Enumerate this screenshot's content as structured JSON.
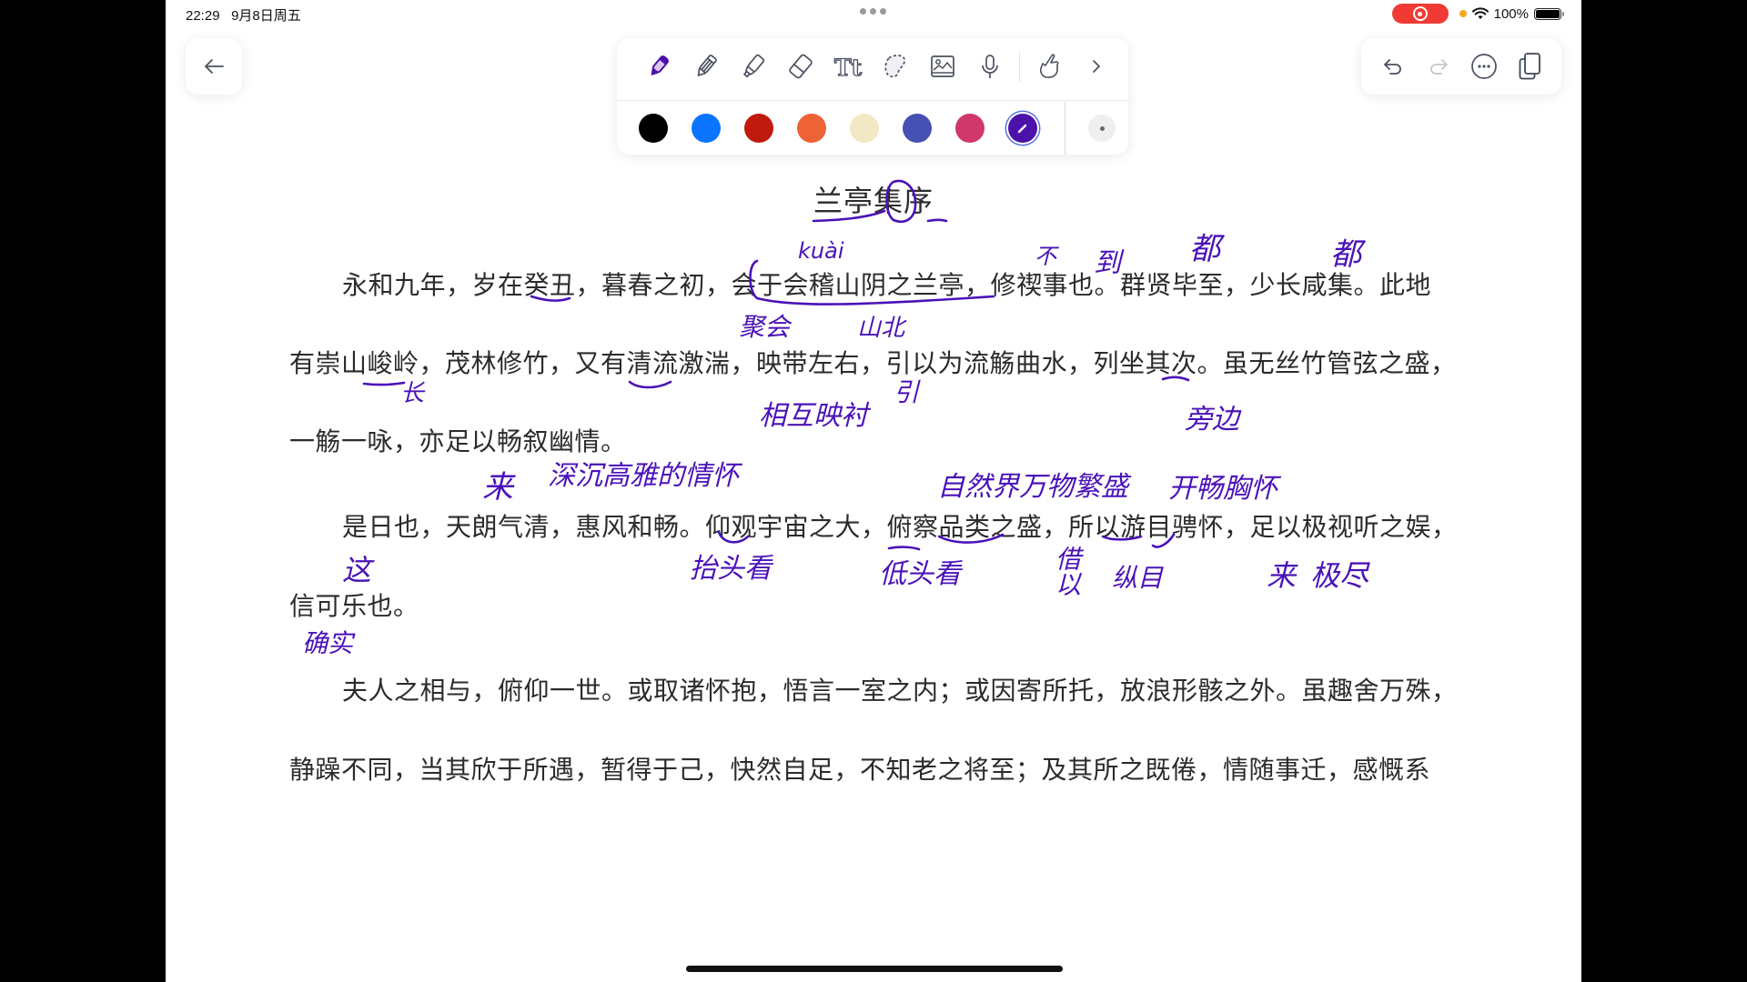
{
  "status_bar": {
    "time": "22:29",
    "date": "9月8日周五",
    "battery": "100%",
    "recording_color": "#ef3b34"
  },
  "nav": {
    "back_icon": "arrow-left-icon"
  },
  "toolbar": {
    "tools": [
      {
        "name": "pen",
        "icon": "fountain-pen-icon",
        "selected": true
      },
      {
        "name": "pencil",
        "icon": "pencil-icon"
      },
      {
        "name": "highlighter",
        "icon": "highlighter-icon"
      },
      {
        "name": "eraser",
        "icon": "eraser-icon"
      },
      {
        "name": "text",
        "icon": "text-tool-icon",
        "label": "Tt"
      },
      {
        "name": "lasso",
        "icon": "lasso-icon"
      },
      {
        "name": "image",
        "icon": "image-icon"
      },
      {
        "name": "microphone",
        "icon": "microphone-icon"
      },
      {
        "name": "touch-draw",
        "icon": "hand-pointer-icon"
      },
      {
        "name": "more-tools",
        "icon": "chevron-right-icon",
        "label": "›"
      }
    ],
    "colors": [
      {
        "name": "black",
        "hex": "#000000"
      },
      {
        "name": "blue",
        "hex": "#0a74ff"
      },
      {
        "name": "red",
        "hex": "#c0190e"
      },
      {
        "name": "orange",
        "hex": "#ee6238"
      },
      {
        "name": "cream",
        "hex": "#f3e8c6"
      },
      {
        "name": "indigo",
        "hex": "#4650b3"
      },
      {
        "name": "pink",
        "hex": "#d0376a"
      },
      {
        "name": "purple",
        "hex": "#4b11a8",
        "selected": true
      }
    ],
    "stroke_size": "small"
  },
  "right_toolbar": {
    "undo_icon": "undo-icon",
    "redo_icon": "redo-icon",
    "more_icon": "ellipsis-circle-icon",
    "pages_icon": "pages-copy-icon"
  },
  "document": {
    "title": "兰亭集序",
    "paragraphs": [
      {
        "lines": [
          "永和九年，岁在癸丑，暮春之初，会于会稽山阴之兰亭，修禊事也。群贤毕至，少长咸集。此地",
          "有崇山峻岭，茂林修竹，又有清流激湍，映带左右，引以为流觞曲水，列坐其次。虽无丝竹管弦之盛，",
          "一觞一咏，亦足以畅叙幽情。"
        ]
      },
      {
        "lines": [
          "是日也，天朗气清，惠风和畅。仰观宇宙之大，俯察品类之盛，所以游目骋怀，足以极视听之娱，",
          "信可乐也。"
        ]
      },
      {
        "lines": [
          "夫人之相与，俯仰一世。或取诸怀抱，悟言一室之内；或因寄所托，放浪形骸之外。虽趣舍万殊，",
          "静躁不同，当其欣于所遇，暂得于己，快然自足，不知老之将至；及其所之既倦，情随事迁，感慨系"
        ]
      }
    ],
    "annotations": [
      {
        "text": "kuài",
        "near": "会"
      },
      {
        "text": "聚会",
        "near": "会于"
      },
      {
        "text": "山北",
        "near": "山阴"
      },
      {
        "text": "不",
        "near": "修禊"
      },
      {
        "text": "到",
        "near": "毕至"
      },
      {
        "text": "都",
        "near": "毕"
      },
      {
        "text": "都",
        "near": "咸"
      },
      {
        "text": "长",
        "near": "修竹"
      },
      {
        "text": "相互映衬",
        "near": "映带"
      },
      {
        "text": "引",
        "near": "引以为"
      },
      {
        "text": "旁边",
        "near": "其次"
      },
      {
        "text": "来",
        "near": "以"
      },
      {
        "text": "深沉高雅的情怀",
        "near": "幽情"
      },
      {
        "text": "这",
        "near": "是日也"
      },
      {
        "text": "抬头看",
        "near": "仰观"
      },
      {
        "text": "低头看",
        "near": "俯察"
      },
      {
        "text": "自然界万物繁盛",
        "near": "品类之盛"
      },
      {
        "text": "开畅胸怀",
        "near": "骋怀"
      },
      {
        "text": "借以",
        "near": "所以"
      },
      {
        "text": "纵目",
        "near": "游目"
      },
      {
        "text": "来",
        "near": "以"
      },
      {
        "text": "极尽",
        "near": "极"
      },
      {
        "text": "确实",
        "near": "信"
      }
    ],
    "ink_color": "#4a12b8"
  }
}
